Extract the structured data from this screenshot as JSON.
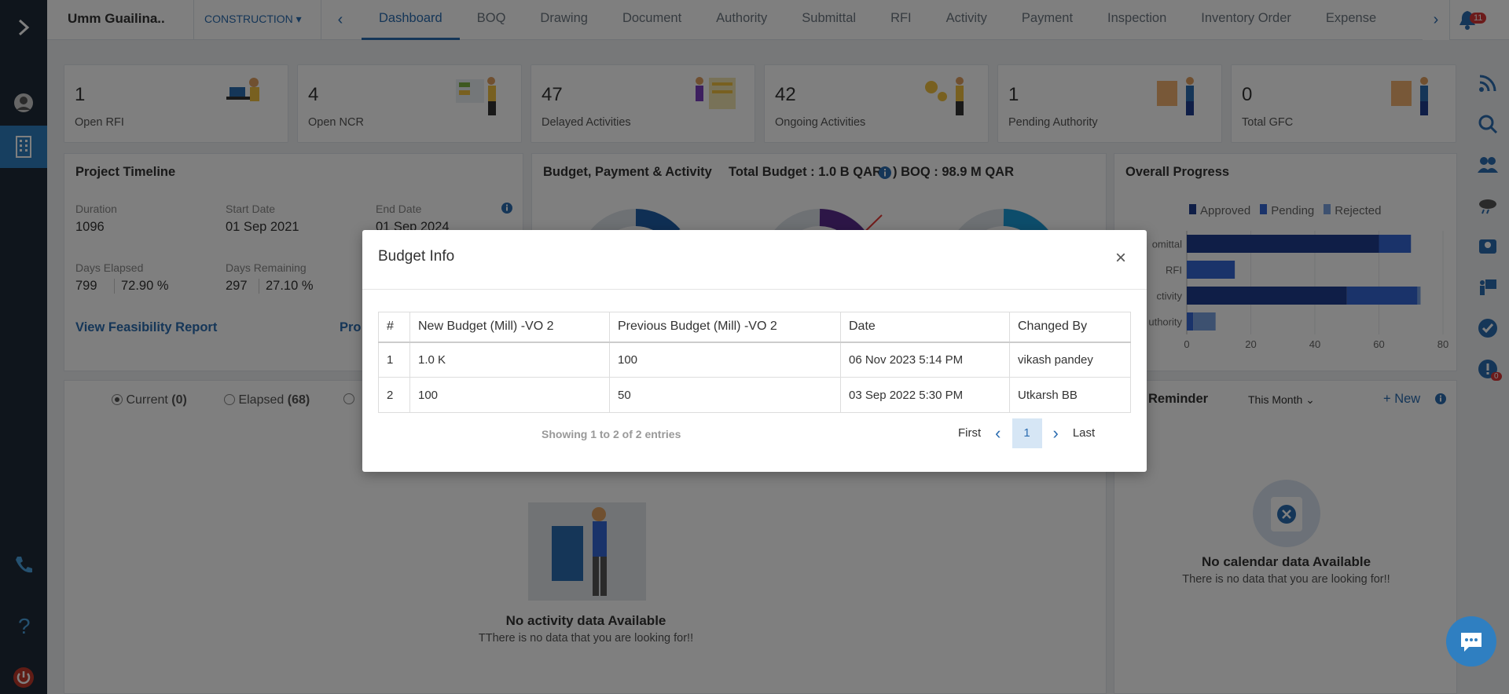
{
  "header": {
    "project_name": "Umm Guailina..",
    "project_type": "CONSTRUCTION",
    "tabs": [
      "Dashboard",
      "BOQ",
      "Drawing",
      "Document",
      "Authority",
      "Submittal",
      "RFI",
      "Activity",
      "Payment",
      "Inspection",
      "Inventory Order",
      "Expense"
    ],
    "notification_count": "11"
  },
  "stats": [
    {
      "value": "1",
      "label": "Open RFI"
    },
    {
      "value": "4",
      "label": "Open NCR"
    },
    {
      "value": "47",
      "label": "Delayed Activities"
    },
    {
      "value": "42",
      "label": "Ongoing Activities"
    },
    {
      "value": "1",
      "label": "Pending Authority"
    },
    {
      "value": "0",
      "label": "Total GFC"
    }
  ],
  "timeline": {
    "title": "Project Timeline",
    "duration_label": "Duration",
    "duration": "1096",
    "start_label": "Start Date",
    "start": "01 Sep 2021",
    "end_label": "End Date",
    "end": "01 Sep 2024",
    "elapsed_label": "Days Elapsed",
    "elapsed_days": "799",
    "elapsed_pct": "72.90 %",
    "remaining_label": "Days Remaining",
    "remaining_days": "297",
    "remaining_pct": "27.10 %",
    "feasibility_link": "View Feasibility Report",
    "other_link": "Pro"
  },
  "budget_panel": {
    "title": "Budget, Payment & Activity",
    "total_budget": "Total Budget : 1.0 B QAR(",
    "boq": ") BOQ : 98.9 M QAR"
  },
  "progress": {
    "title": "Overall Progress",
    "legend": [
      "Approved",
      "Pending",
      "Rejected"
    ],
    "colors": {
      "approved": "#1f3d8f",
      "pending": "#3566d4",
      "rejected": "#7aa2e0"
    }
  },
  "chart_data": {
    "type": "bar",
    "orientation": "horizontal",
    "categories": [
      "Submittal",
      "RFI",
      "Activity",
      "Authority"
    ],
    "series": [
      {
        "name": "Approved",
        "values": [
          60,
          0,
          50,
          0
        ]
      },
      {
        "name": "Pending",
        "values": [
          10,
          15,
          22,
          2
        ]
      },
      {
        "name": "Rejected",
        "values": [
          0,
          0,
          1,
          7
        ]
      }
    ],
    "xlim": [
      0,
      80
    ],
    "xticks": [
      "0",
      "20",
      "40",
      "60",
      "80"
    ],
    "visible_category_labels": [
      "omittal",
      "RFI",
      "ctivity",
      "uthority"
    ],
    "legend_position": "top"
  },
  "activity": {
    "filters": [
      {
        "label": "Current",
        "count": "(0)"
      },
      {
        "label": "Elapsed",
        "count": "(68)"
      }
    ],
    "empty_title": "No activity data Available",
    "empty_sub": "TThere is no data that you are looking for!!"
  },
  "reminder": {
    "title": "Reminder",
    "period": "This Month",
    "new_label": "+ New",
    "empty_title": "No calendar data Available",
    "empty_sub": "There is no data that you are looking for!!"
  },
  "modal": {
    "title": "Budget Info",
    "close": "×",
    "columns": [
      "#",
      "New Budget (Mill) -VO 2",
      "Previous Budget (Mill) -VO 2",
      "Date",
      "Changed By"
    ],
    "rows": [
      [
        "1",
        "1.0 K",
        "100",
        "06 Nov 2023 5:14 PM",
        "vikash pandey"
      ],
      [
        "2",
        "100",
        "50",
        "03 Sep 2022 5:30 PM",
        "Utkarsh BB"
      ]
    ],
    "showing": "Showing 1 to 2 of 2 entries",
    "first": "First",
    "page": "1",
    "last": "Last"
  },
  "right_badge": "0"
}
